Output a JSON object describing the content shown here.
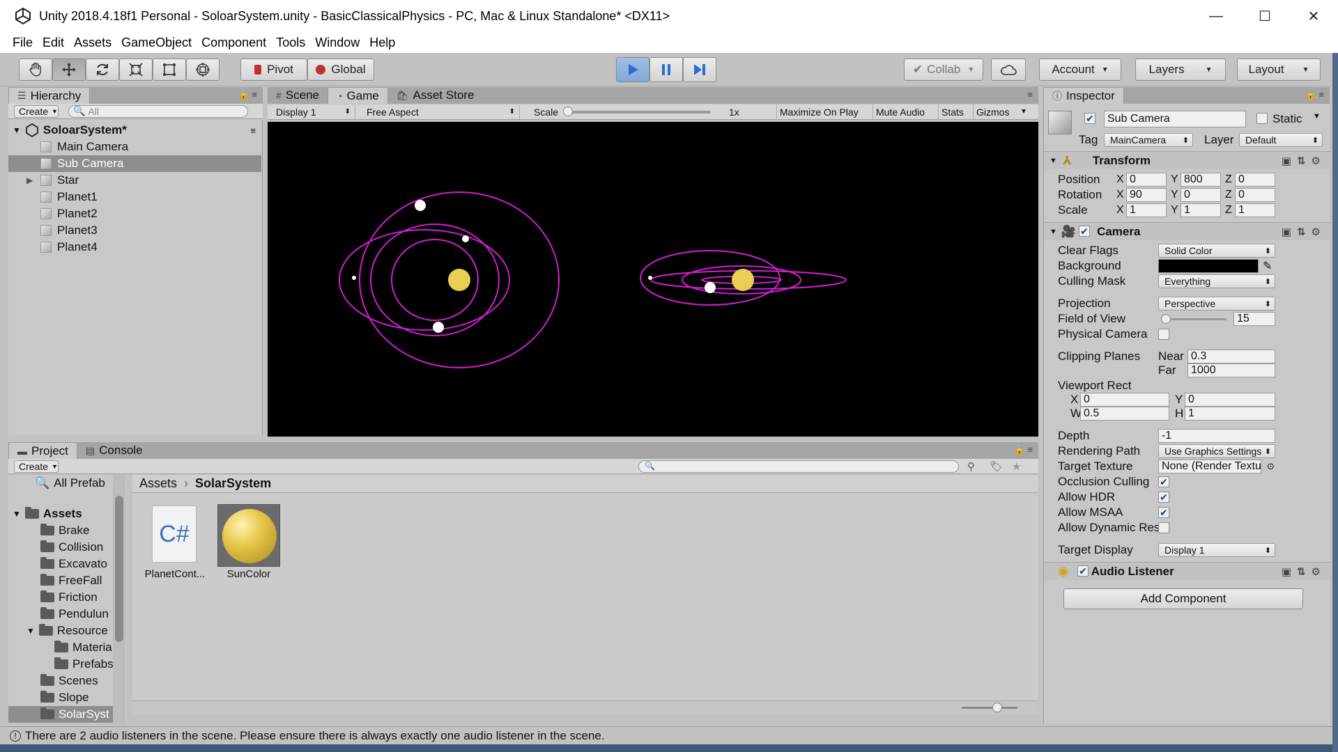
{
  "window": {
    "title": "Unity 2018.4.18f1 Personal - SoloarSystem.unity - BasicClassicalPhysics - PC, Mac & Linux Standalone* <DX11>",
    "controls": [
      "—",
      "☐",
      "✕"
    ]
  },
  "menu": [
    "File",
    "Edit",
    "Assets",
    "GameObject",
    "Component",
    "Tools",
    "Window",
    "Help"
  ],
  "toolbar": {
    "tools": [
      "hand-icon",
      "move-icon",
      "rotate-icon",
      "scale-icon",
      "rect-icon",
      "transform-icon"
    ],
    "pivot": "Pivot",
    "global": "Global",
    "collab": "Collab",
    "account": "Account",
    "layers": "Layers",
    "layout": "Layout"
  },
  "hierarchy": {
    "tab": "Hierarchy",
    "create": "Create",
    "search_placeholder": "All",
    "scene": "SoloarSystem*",
    "items": [
      "Main Camera",
      "Sub Camera",
      "Star",
      "Planet1",
      "Planet2",
      "Planet3",
      "Planet4"
    ],
    "selected": "Sub Camera"
  },
  "center_tabs": [
    "Scene",
    "Game",
    "Asset Store"
  ],
  "game_toolbar": {
    "display": "Display 1",
    "aspect": "Free Aspect",
    "scale_label": "Scale",
    "scale_value": "1x",
    "maximize": "Maximize On Play",
    "mute": "Mute Audio",
    "stats": "Stats",
    "gizmos": "Gizmos"
  },
  "project": {
    "tabs": [
      "Project",
      "Console"
    ],
    "create": "Create",
    "breadcrumb_root": "Assets",
    "breadcrumb_current": "SolarSystem",
    "tree": [
      {
        "label": "All Prefab",
        "indent": 0
      },
      {
        "label": "Assets",
        "indent": 0
      },
      {
        "label": "Brake",
        "indent": 1
      },
      {
        "label": "Collision",
        "indent": 1
      },
      {
        "label": "Excavato",
        "indent": 1
      },
      {
        "label": "FreeFall",
        "indent": 1
      },
      {
        "label": "Friction",
        "indent": 1
      },
      {
        "label": "Pendulun",
        "indent": 1
      },
      {
        "label": "Resource",
        "indent": 1
      },
      {
        "label": "Materia",
        "indent": 2
      },
      {
        "label": "Prefabs",
        "indent": 2
      },
      {
        "label": "Scenes",
        "indent": 1
      },
      {
        "label": "Slope",
        "indent": 1
      },
      {
        "label": "SolarSyst",
        "indent": 1
      }
    ],
    "assets": [
      {
        "name": "PlanetCont...",
        "type": "script",
        "glyph": "C#"
      },
      {
        "name": "SunColor",
        "type": "material"
      }
    ]
  },
  "inspector": {
    "tab": "Inspector",
    "object_name": "Sub Camera",
    "static_label": "Static",
    "tag_label": "Tag",
    "tag_value": "MainCamera",
    "layer_label": "Layer",
    "layer_value": "Default",
    "transform": {
      "title": "Transform",
      "position_label": "Position",
      "rotation_label": "Rotation",
      "scale_label": "Scale",
      "axis_x": "X",
      "axis_y": "Y",
      "axis_z": "Z",
      "position": [
        "0",
        "800",
        "0"
      ],
      "rotation": [
        "90",
        "0",
        "0"
      ],
      "scale": [
        "1",
        "1",
        "1"
      ]
    },
    "camera": {
      "title": "Camera",
      "clear_flags_label": "Clear Flags",
      "clear_flags": "Solid Color",
      "background_label": "Background",
      "background_color": "#000000",
      "culling_mask_label": "Culling Mask",
      "culling_mask": "Everything",
      "projection_label": "Projection",
      "projection": "Perspective",
      "fov_label": "Field of View",
      "fov": "15",
      "physical_label": "Physical Camera",
      "clipping_label": "Clipping Planes",
      "near_label": "Near",
      "near": "0.3",
      "far_label": "Far",
      "far": "1000",
      "viewport_label": "Viewport Rect",
      "vx_label": "X",
      "vy_label": "Y",
      "vw_label": "W",
      "vh_label": "H",
      "vx": "0",
      "vy": "0",
      "vw": "0.5",
      "vh": "1",
      "depth_label": "Depth",
      "depth": "-1",
      "rendering_path_label": "Rendering Path",
      "rendering_path": "Use Graphics Settings",
      "target_texture_label": "Target Texture",
      "target_texture": "None (Render Textu",
      "occlusion_label": "Occlusion Culling",
      "hdr_label": "Allow HDR",
      "msaa_label": "Allow MSAA",
      "dynamic_label": "Allow Dynamic Reso",
      "target_display_label": "Target Display",
      "target_display": "Display 1"
    },
    "audio_listener": "Audio Listener",
    "add_component": "Add Component"
  },
  "status": "There are 2 audio listeners in the scene. Please ensure there is always exactly one audio listener in the scene.",
  "colors": {
    "accent_blue": "#3f8be0",
    "orbit_magenta": "#d21ed2",
    "sun_yellow": "#e8cf52"
  }
}
